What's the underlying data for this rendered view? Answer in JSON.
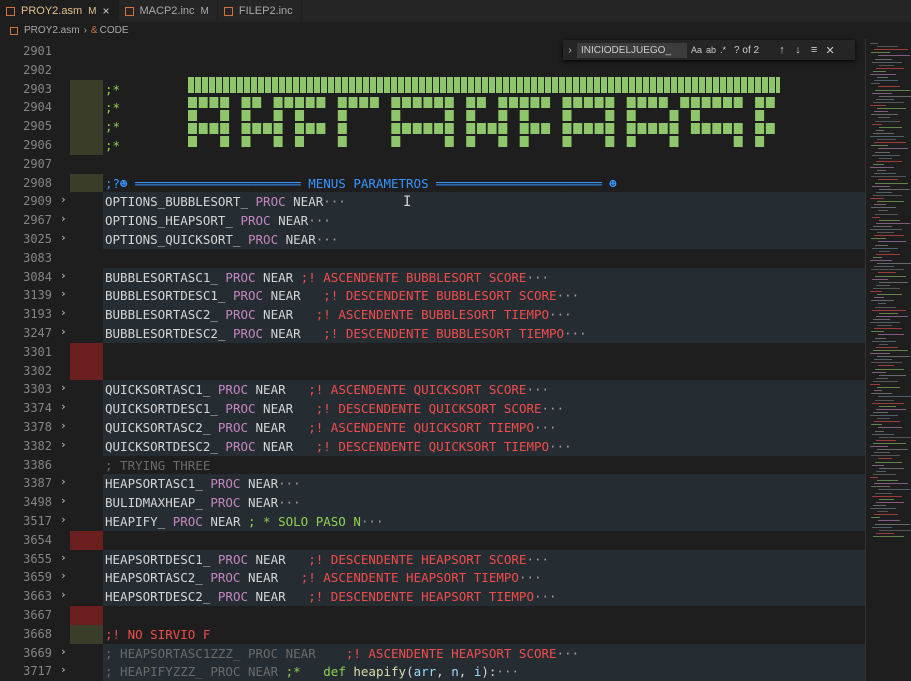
{
  "tabs": [
    {
      "label": "PROY2.asm",
      "mod": "M",
      "active": true
    },
    {
      "label": "MACP2.inc",
      "mod": "M",
      "active": false
    },
    {
      "label": "FILEP2.inc",
      "mod": "",
      "active": false
    }
  ],
  "breadcrumb": {
    "file": "PROY2.asm",
    "symbol": "CODE"
  },
  "find": {
    "value": "INICIODELJUEGO_",
    "case_label": "Aa",
    "word_label": "ab",
    "count": "? of 2"
  },
  "lines": [
    {
      "n": "2901",
      "fold": false,
      "hl": "",
      "block": false,
      "parts": []
    },
    {
      "n": "2902",
      "fold": false,
      "hl": "",
      "block": false,
      "parts": []
    },
    {
      "n": "2903",
      "fold": false,
      "hl": "olive",
      "block": false,
      "parts": [
        {
          "t": ";*",
          "c": "green"
        }
      ]
    },
    {
      "n": "2904",
      "fold": false,
      "hl": "olive",
      "block": false,
      "parts": [
        {
          "t": ";*",
          "c": "green"
        }
      ]
    },
    {
      "n": "2905",
      "fold": false,
      "hl": "olive",
      "block": false,
      "parts": [
        {
          "t": ";*",
          "c": "green"
        }
      ]
    },
    {
      "n": "2906",
      "fold": false,
      "hl": "olive",
      "block": false,
      "parts": [
        {
          "t": ";*",
          "c": "green"
        }
      ]
    },
    {
      "n": "2907",
      "fold": false,
      "hl": "",
      "block": false,
      "parts": []
    },
    {
      "n": "2908",
      "fold": false,
      "hl": "olive",
      "block": false,
      "parts": [
        {
          "t": ";?☻ ══════════════════════ ",
          "c": "blue"
        },
        {
          "t": "MENUS PARAMETROS",
          "c": "blue"
        },
        {
          "t": " ══════════════════════ ☻",
          "c": "blue"
        }
      ]
    },
    {
      "n": "2909",
      "fold": true,
      "hl": "",
      "block": true,
      "parts": [
        {
          "t": "OPTIONS_BUBBLESORT_ ",
          "c": "ident"
        },
        {
          "t": "PROC",
          "c": "kw"
        },
        {
          "t": " NEAR",
          "c": "ident"
        },
        {
          "t": "···",
          "c": "more"
        }
      ]
    },
    {
      "n": "2967",
      "fold": true,
      "hl": "",
      "block": true,
      "parts": [
        {
          "t": "OPTIONS_HEAPSORT_ ",
          "c": "ident"
        },
        {
          "t": "PROC",
          "c": "kw"
        },
        {
          "t": " NEAR",
          "c": "ident"
        },
        {
          "t": "···",
          "c": "more"
        }
      ]
    },
    {
      "n": "3025",
      "fold": true,
      "hl": "",
      "block": true,
      "parts": [
        {
          "t": "OPTIONS_QUICKSORT_ ",
          "c": "ident"
        },
        {
          "t": "PROC",
          "c": "kw"
        },
        {
          "t": " NEAR",
          "c": "ident"
        },
        {
          "t": "···",
          "c": "more"
        }
      ]
    },
    {
      "n": "3083",
      "fold": false,
      "hl": "",
      "block": false,
      "parts": []
    },
    {
      "n": "3084",
      "fold": true,
      "hl": "",
      "block": true,
      "parts": [
        {
          "t": "BUBBLESORTASC1_ ",
          "c": "ident"
        },
        {
          "t": "PROC",
          "c": "kw"
        },
        {
          "t": " NEAR ",
          "c": "ident"
        },
        {
          "t": ";! ASCENDENTE BUBBLESORT SCORE",
          "c": "red"
        },
        {
          "t": "···",
          "c": "more"
        }
      ]
    },
    {
      "n": "3139",
      "fold": true,
      "hl": "",
      "block": true,
      "parts": [
        {
          "t": "BUBBLESORTDESC1_ ",
          "c": "ident"
        },
        {
          "t": "PROC",
          "c": "kw"
        },
        {
          "t": " NEAR   ",
          "c": "ident"
        },
        {
          "t": ";! DESCENDENTE BUBBLESORT SCORE",
          "c": "red"
        },
        {
          "t": "···",
          "c": "more"
        }
      ]
    },
    {
      "n": "3193",
      "fold": true,
      "hl": "",
      "block": true,
      "parts": [
        {
          "t": "BUBBLESORTASC2_ ",
          "c": "ident"
        },
        {
          "t": "PROC",
          "c": "kw"
        },
        {
          "t": " NEAR   ",
          "c": "ident"
        },
        {
          "t": ";! ASCENDENTE BUBBLESORT TIEMPO",
          "c": "red"
        },
        {
          "t": "···",
          "c": "more"
        }
      ]
    },
    {
      "n": "3247",
      "fold": true,
      "hl": "",
      "block": true,
      "parts": [
        {
          "t": "BUBBLESORTDESC2_ ",
          "c": "ident"
        },
        {
          "t": "PROC",
          "c": "kw"
        },
        {
          "t": " NEAR   ",
          "c": "ident"
        },
        {
          "t": ";! DESCENDENTE BUBBLESORT TIEMPO",
          "c": "red"
        },
        {
          "t": "···",
          "c": "more"
        }
      ]
    },
    {
      "n": "3301",
      "fold": false,
      "hl": "red",
      "block": false,
      "parts": []
    },
    {
      "n": "3302",
      "fold": false,
      "hl": "red",
      "block": false,
      "parts": []
    },
    {
      "n": "3303",
      "fold": true,
      "hl": "",
      "block": true,
      "parts": [
        {
          "t": "QUICKSORTASC1_ ",
          "c": "ident"
        },
        {
          "t": "PROC",
          "c": "kw"
        },
        {
          "t": " NEAR   ",
          "c": "ident"
        },
        {
          "t": ";! ASCENDENTE QUICKSORT SCORE",
          "c": "red"
        },
        {
          "t": "···",
          "c": "more"
        }
      ]
    },
    {
      "n": "3374",
      "fold": true,
      "hl": "",
      "block": true,
      "parts": [
        {
          "t": "QUICKSORTDESC1_ ",
          "c": "ident"
        },
        {
          "t": "PROC",
          "c": "kw"
        },
        {
          "t": " NEAR   ",
          "c": "ident"
        },
        {
          "t": ";! DESCENDENTE QUICKSORT SCORE",
          "c": "red"
        },
        {
          "t": "···",
          "c": "more"
        }
      ]
    },
    {
      "n": "3378",
      "fold": true,
      "hl": "",
      "block": true,
      "parts": [
        {
          "t": "QUICKSORTASC2_ ",
          "c": "ident"
        },
        {
          "t": "PROC",
          "c": "kw"
        },
        {
          "t": " NEAR   ",
          "c": "ident"
        },
        {
          "t": ";! ASCENDENTE QUICKSORT TIEMPO",
          "c": "red"
        },
        {
          "t": "···",
          "c": "more"
        }
      ]
    },
    {
      "n": "3382",
      "fold": true,
      "hl": "",
      "block": true,
      "parts": [
        {
          "t": "QUICKSORTDESC2_ ",
          "c": "ident"
        },
        {
          "t": "PROC",
          "c": "kw"
        },
        {
          "t": " NEAR   ",
          "c": "ident"
        },
        {
          "t": ";! DESCENDENTE QUICKSORT TIEMPO",
          "c": "red"
        },
        {
          "t": "···",
          "c": "more"
        }
      ]
    },
    {
      "n": "3386",
      "fold": false,
      "hl": "",
      "block": false,
      "parts": [
        {
          "t": "; TRYING THREE",
          "c": "cmt"
        }
      ]
    },
    {
      "n": "3387",
      "fold": true,
      "hl": "",
      "block": true,
      "parts": [
        {
          "t": "HEAPSORTASC1_ ",
          "c": "ident"
        },
        {
          "t": "PROC",
          "c": "kw"
        },
        {
          "t": " NEAR",
          "c": "ident"
        },
        {
          "t": "···",
          "c": "more"
        }
      ]
    },
    {
      "n": "3498",
      "fold": true,
      "hl": "",
      "block": true,
      "parts": [
        {
          "t": "BULIDMAXHEAP_ ",
          "c": "ident"
        },
        {
          "t": "PROC",
          "c": "kw"
        },
        {
          "t": " NEAR",
          "c": "ident"
        },
        {
          "t": "···",
          "c": "more"
        }
      ]
    },
    {
      "n": "3517",
      "fold": true,
      "hl": "",
      "block": true,
      "parts": [
        {
          "t": "HEAPIFY_ ",
          "c": "ident"
        },
        {
          "t": "PROC",
          "c": "kw"
        },
        {
          "t": " NEAR ",
          "c": "ident"
        },
        {
          "t": "; * SOLO PASO N",
          "c": "green"
        },
        {
          "t": "···",
          "c": "more"
        }
      ]
    },
    {
      "n": "3654",
      "fold": false,
      "hl": "red",
      "block": false,
      "parts": []
    },
    {
      "n": "3655",
      "fold": true,
      "hl": "",
      "block": true,
      "parts": [
        {
          "t": "HEAPSORTDESC1_ ",
          "c": "ident"
        },
        {
          "t": "PROC",
          "c": "kw"
        },
        {
          "t": " NEAR   ",
          "c": "ident"
        },
        {
          "t": ";! DESCENDENTE HEAPSORT SCORE",
          "c": "red"
        },
        {
          "t": "···",
          "c": "more"
        }
      ]
    },
    {
      "n": "3659",
      "fold": true,
      "hl": "",
      "block": true,
      "parts": [
        {
          "t": "HEAPSORTASC2_ ",
          "c": "ident"
        },
        {
          "t": "PROC",
          "c": "kw"
        },
        {
          "t": " NEAR   ",
          "c": "ident"
        },
        {
          "t": ";! ASCENDENTE HEAPSORT TIEMPO",
          "c": "red"
        },
        {
          "t": "···",
          "c": "more"
        }
      ]
    },
    {
      "n": "3663",
      "fold": true,
      "hl": "",
      "block": true,
      "parts": [
        {
          "t": "HEAPSORTDESC2_ ",
          "c": "ident"
        },
        {
          "t": "PROC",
          "c": "kw"
        },
        {
          "t": " NEAR   ",
          "c": "ident"
        },
        {
          "t": ";! DESCENDENTE HEAPSORT TIEMPO",
          "c": "red"
        },
        {
          "t": "···",
          "c": "more"
        }
      ]
    },
    {
      "n": "3667",
      "fold": false,
      "hl": "red",
      "block": false,
      "parts": []
    },
    {
      "n": "3668",
      "fold": false,
      "hl": "olive",
      "block": false,
      "parts": [
        {
          "t": ";! NO SIRVIO F",
          "c": "red"
        }
      ]
    },
    {
      "n": "3669",
      "fold": true,
      "hl": "",
      "block": true,
      "parts": [
        {
          "t": "; HEAPSORTASC1ZZZ_ PROC NEAR    ",
          "c": "cmt"
        },
        {
          "t": ";! ASCENDENTE HEAPSORT SCORE",
          "c": "red"
        },
        {
          "t": "···",
          "c": "more"
        }
      ]
    },
    {
      "n": "3717",
      "fold": true,
      "hl": "",
      "block": true,
      "parts": [
        {
          "t": "; HEAPIFYZZZ_ PROC NEAR ",
          "c": "cmt"
        },
        {
          "t": ";*   ",
          "c": "green"
        },
        {
          "t": "def ",
          "c": "green"
        },
        {
          "t": "heapify",
          "c": "fn"
        },
        {
          "t": "(",
          "c": "ident"
        },
        {
          "t": "arr",
          "c": "var"
        },
        {
          "t": ", ",
          "c": "ident"
        },
        {
          "t": "n",
          "c": "var"
        },
        {
          "t": ", ",
          "c": "ident"
        },
        {
          "t": "i",
          "c": "var"
        },
        {
          "t": "):",
          "c": "ident"
        },
        {
          "t": "···",
          "c": "more"
        }
      ]
    }
  ],
  "colors": {
    "olive_hl": "#3b3d2b",
    "red_hl": "#6b1f1f",
    "block_bg": "#252d33",
    "banner_green": "#8fc56b"
  }
}
